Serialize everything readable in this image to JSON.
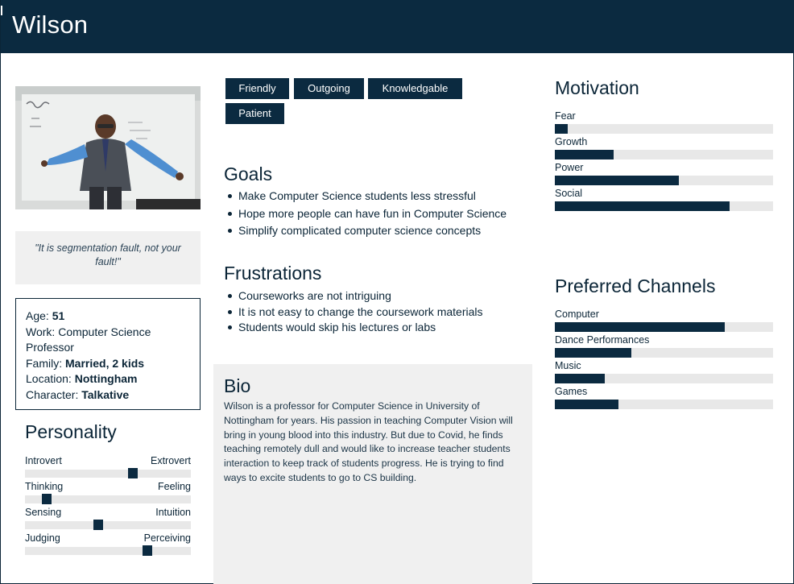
{
  "header": {
    "name": "Wilson"
  },
  "quote": "\"It is segmentation fault, not your fault!\"",
  "facts": {
    "age_label": "Age:",
    "age": "51",
    "work_label": "Work:",
    "work": "Computer Science Professor",
    "family_label": "Family:",
    "family": "Married, 2 kids",
    "location_label": "Location:",
    "location": "Nottingham",
    "character_label": "Character:",
    "character": "Talkative"
  },
  "personality": {
    "title": "Personality",
    "sliders": [
      {
        "left": "Introvert",
        "right": "Extrovert",
        "value": 0.65
      },
      {
        "left": "Thinking",
        "right": "Feeling",
        "value": 0.13
      },
      {
        "left": "Sensing",
        "right": "Intuition",
        "value": 0.44
      },
      {
        "left": "Judging",
        "right": "Perceiving",
        "value": 0.74
      }
    ]
  },
  "tags": [
    "Friendly",
    "Outgoing",
    "Knowledgable",
    "Patient"
  ],
  "goals": {
    "title": "Goals",
    "items": [
      "Make Computer Science students less stressful",
      "Hope more people can have fun in Computer Science",
      "Simplify complicated computer science concepts"
    ]
  },
  "frustrations": {
    "title": "Frustrations",
    "items": [
      "Courseworks are not intriguing",
      "It is not easy to change the coursework materials",
      "Students would skip his lectures or labs"
    ]
  },
  "bio": {
    "title": "Bio",
    "text": "Wilson is a professor for Computer Science in University of Nottingham for years. His passion in teaching Computer Vision will bring in young blood into this industry. But due to Covid, he finds teaching remotely dull and would like to increase teacher students interaction to keep track of students progress. He is trying to find ways to excite students to go to CS building."
  },
  "motivation": {
    "title": "Motivation",
    "bars": [
      {
        "label": "Fear",
        "value": 0.06
      },
      {
        "label": "Growth",
        "value": 0.27
      },
      {
        "label": "Power",
        "value": 0.57
      },
      {
        "label": "Social",
        "value": 0.8
      }
    ]
  },
  "channels": {
    "title": "Preferred Channels",
    "bars": [
      {
        "label": "Computer",
        "value": 0.78
      },
      {
        "label": "Dance Performances",
        "value": 0.35
      },
      {
        "label": "Music",
        "value": 0.23
      },
      {
        "label": "Games",
        "value": 0.29
      }
    ]
  },
  "colors": {
    "primary": "#0b2a40",
    "track": "#e8e8e8",
    "panel": "#f0f0f0"
  }
}
